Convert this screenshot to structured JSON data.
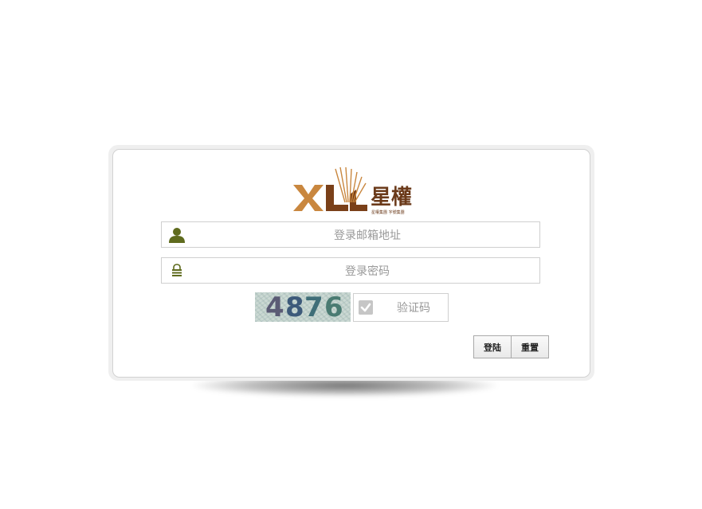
{
  "login": {
    "email_placeholder": "登录邮箱地址",
    "password_placeholder": "登录密码",
    "captcha_code": [
      "4",
      "8",
      "7",
      "6"
    ],
    "captcha_placeholder": "验证码",
    "login_label": "登陆",
    "reset_label": "重置"
  },
  "logo": {
    "latin": "XL",
    "chinese": "星權",
    "tagline": "星權集團 字號集團"
  },
  "colors": {
    "logo_orange": "#c9873f",
    "logo_brown": "#6b3a1a",
    "icon_green": "#5f6b1e"
  },
  "icons": {
    "user": "user-icon",
    "lock": "lock-icon",
    "check": "check-icon"
  }
}
